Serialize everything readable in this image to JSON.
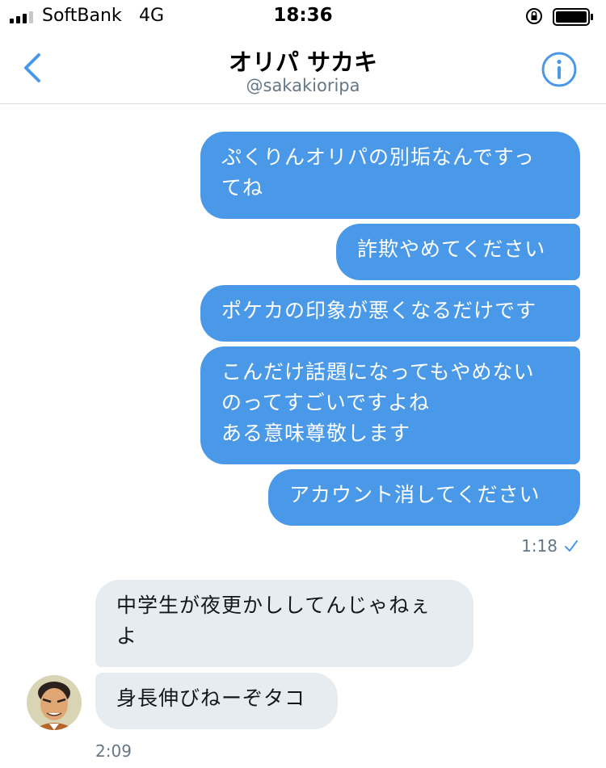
{
  "status_bar": {
    "carrier": "SoftBank",
    "network": "4G",
    "time": "18:36"
  },
  "header": {
    "title": "オリパ サカキ",
    "handle": "@sakakioripa"
  },
  "messages_sent": [
    {
      "lines": [
        "ぷくりんオリパの別垢なんですっ",
        "てね"
      ]
    },
    {
      "lines": [
        "詐欺やめてください"
      ]
    },
    {
      "lines": [
        "ポケカの印象が悪くなるだけです"
      ]
    },
    {
      "lines": [
        "こんだけ話題になってもやめない",
        "のってすごいですよね",
        "ある意味尊敬します"
      ]
    },
    {
      "lines": [
        "アカウント消してください"
      ]
    }
  ],
  "sent_time": "1:18",
  "messages_received": [
    {
      "lines": [
        "中学生が夜更かししてんじゃねぇ",
        "よ"
      ]
    },
    {
      "lines": [
        "身長伸びねーぞタコ"
      ]
    }
  ],
  "received_time": "2:09",
  "colors": {
    "accent": "#4a99e9",
    "received_bubble": "#e6ecf0",
    "secondary_text": "#657786"
  },
  "icons": [
    "back-icon",
    "info-icon",
    "lock-icon",
    "battery-icon",
    "check-icon"
  ]
}
